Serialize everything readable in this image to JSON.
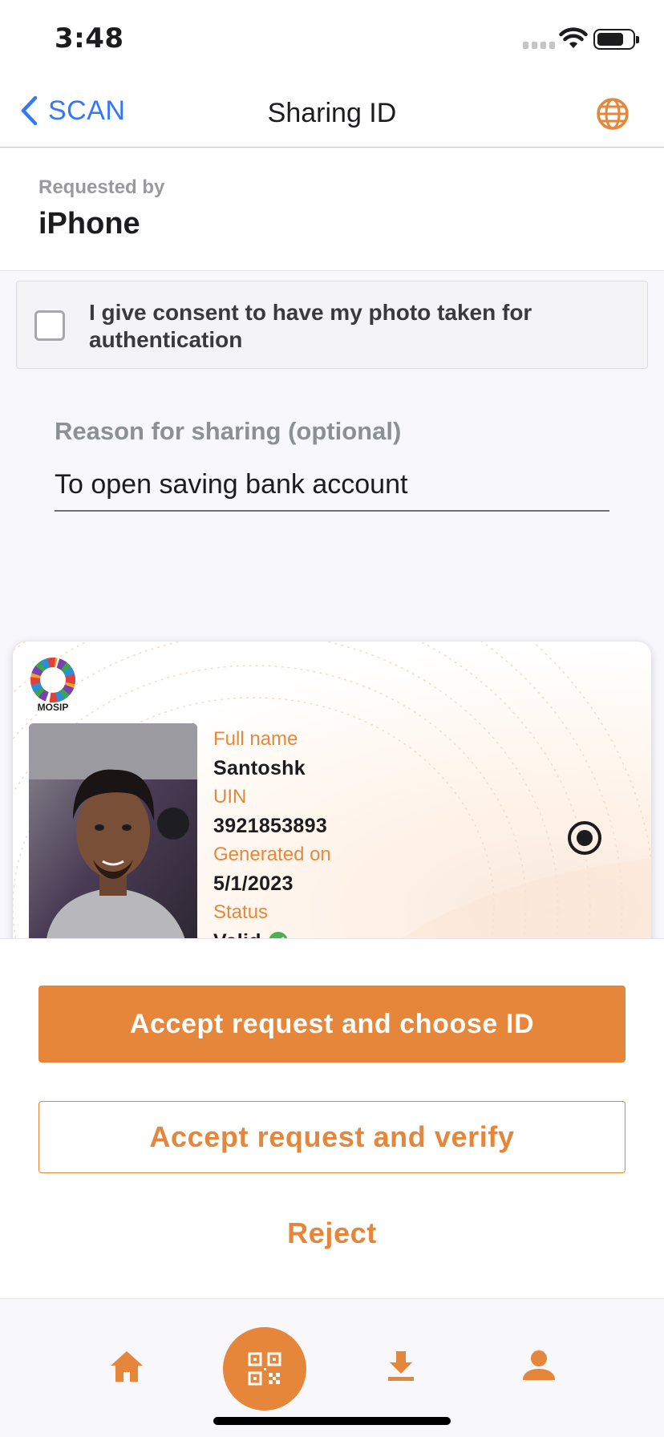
{
  "status_bar": {
    "time": "3:48"
  },
  "nav": {
    "back_label": "SCAN",
    "title": "Sharing ID"
  },
  "request": {
    "caption": "Requested by",
    "requester": "iPhone"
  },
  "consent": {
    "text": "I give consent to have my photo taken for authentication",
    "checked": false
  },
  "reason": {
    "label": "Reason for sharing (optional)",
    "value": "To open saving bank account"
  },
  "card": {
    "logo_text": "MOSIP",
    "full_name_label": "Full name",
    "full_name": "Santoshk",
    "uin_label": "UIN",
    "uin": "3921853893",
    "generated_label": "Generated on",
    "generated": "5/1/2023",
    "status_label": "Status",
    "status": "Valid",
    "selected": true
  },
  "actions": {
    "primary": "Accept request and choose ID",
    "secondary": "Accept request and verify",
    "reject": "Reject"
  },
  "tabs": [
    "home-icon",
    "scan-icon",
    "download-icon",
    "profile-icon"
  ],
  "colors": {
    "accent": "#e5863b",
    "link": "#3478f6",
    "valid": "#4caf50"
  }
}
